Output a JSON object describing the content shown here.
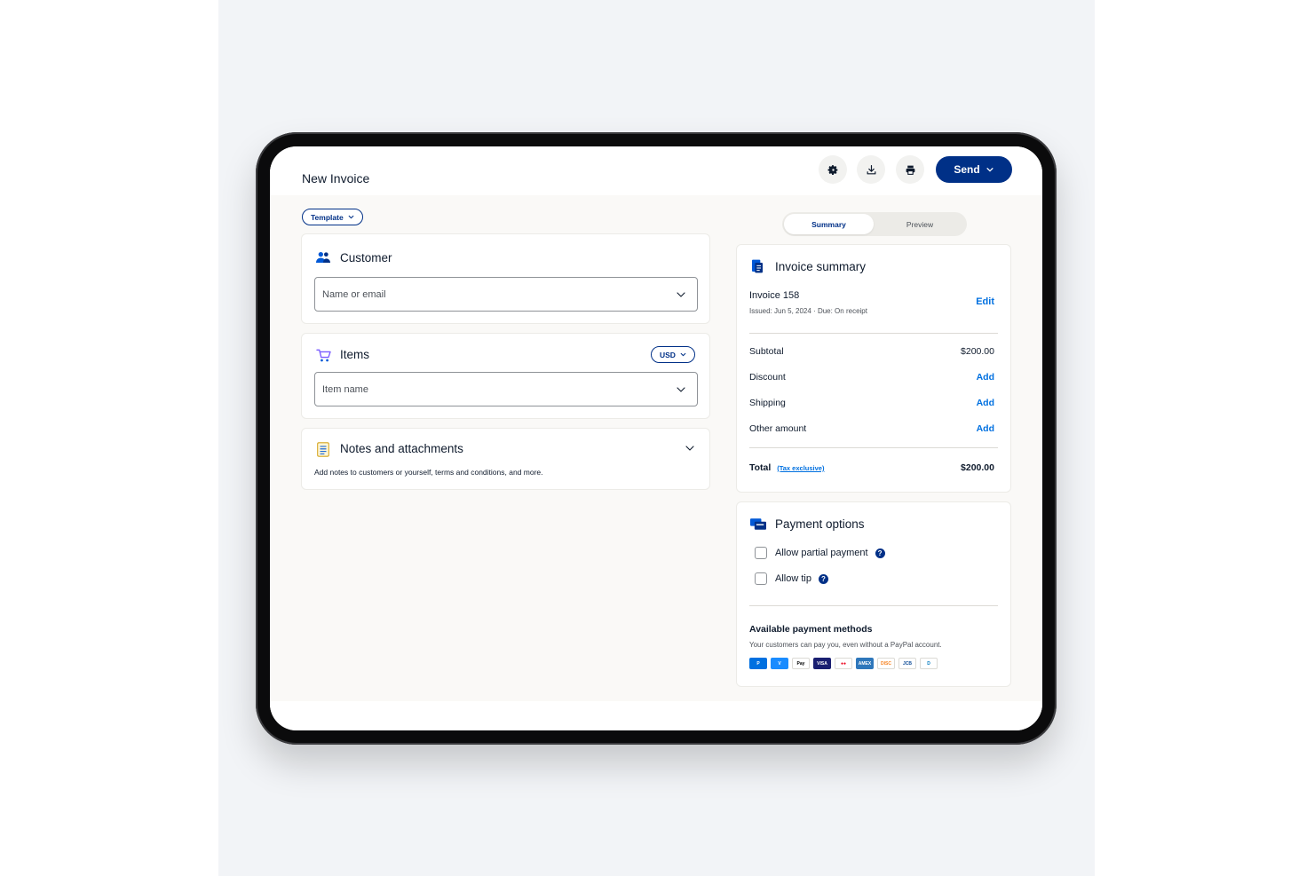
{
  "header": {
    "title": "New Invoice",
    "settings_icon": "gear-icon",
    "download_icon": "download-icon",
    "print_icon": "printer-icon",
    "send_label": "Send"
  },
  "left": {
    "template_label": "Template",
    "customer": {
      "title": "Customer",
      "placeholder": "Name or email"
    },
    "items": {
      "title": "Items",
      "currency": "USD",
      "placeholder": "Item name"
    },
    "notes": {
      "title": "Notes and attachments",
      "description": "Add notes to customers or yourself, terms and conditions, and more."
    }
  },
  "tabs": {
    "active": "Summary",
    "inactive": "Preview"
  },
  "summary": {
    "title": "Invoice summary",
    "invoice_name": "Invoice 158",
    "meta": "Issued: Jun 5, 2024 · Due: On receipt",
    "edit_label": "Edit",
    "subtotal_label": "Subtotal",
    "subtotal_value": "$200.00",
    "discount_label": "Discount",
    "shipping_label": "Shipping",
    "other_label": "Other amount",
    "add_label": "Add",
    "total_label": "Total",
    "tax_note": "(Tax exclusive)",
    "total_value": "$200.00"
  },
  "payment": {
    "title": "Payment options",
    "partial_label": "Allow partial payment",
    "tip_label": "Allow tip",
    "help_glyph": "?",
    "methods_title": "Available payment methods",
    "methods_desc": "Your customers can pay you, even without a PayPal account.",
    "methods": [
      {
        "label": "P",
        "bg": "#0070e0",
        "fg": "#ffffff"
      },
      {
        "label": "V",
        "bg": "#1a8cff",
        "fg": "#ffffff"
      },
      {
        "label": "Pay",
        "bg": "#ffffff",
        "fg": "#000000"
      },
      {
        "label": "VISA",
        "bg": "#1a1f71",
        "fg": "#ffffff"
      },
      {
        "label": "●●",
        "bg": "#ffffff",
        "fg": "#eb001b"
      },
      {
        "label": "AMEX",
        "bg": "#2e77bb",
        "fg": "#ffffff"
      },
      {
        "label": "DISC",
        "bg": "#ffffff",
        "fg": "#f58220"
      },
      {
        "label": "JCB",
        "bg": "#ffffff",
        "fg": "#0e4c96"
      },
      {
        "label": "D",
        "bg": "#ffffff",
        "fg": "#0079be"
      }
    ]
  },
  "colors": {
    "brand": "#003087",
    "link": "#0070e0"
  }
}
